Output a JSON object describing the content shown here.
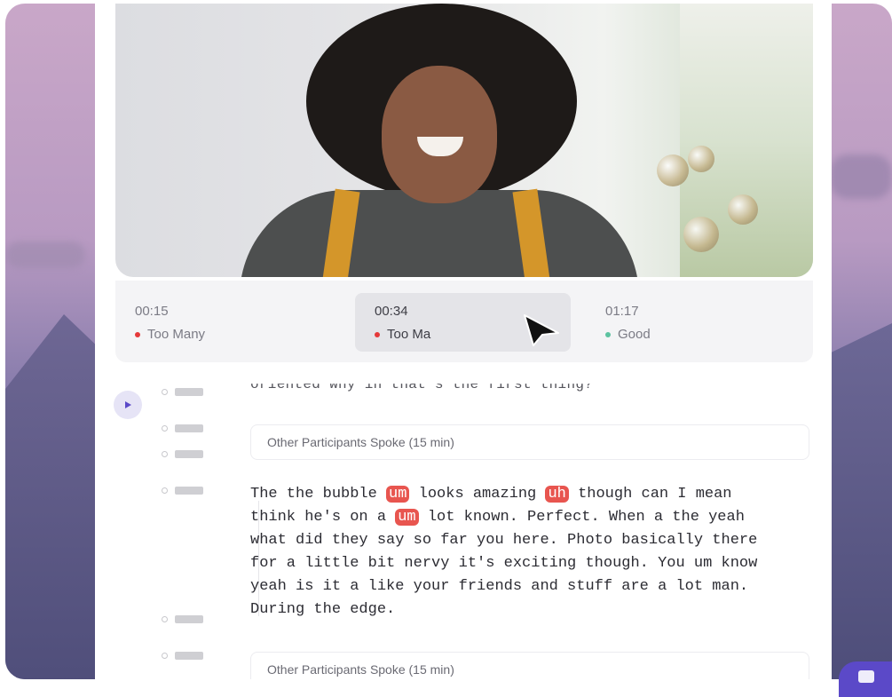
{
  "timeline": {
    "segments": [
      {
        "time": "00:15",
        "status": "Too Many",
        "status_color": "#e5393a",
        "active": false
      },
      {
        "time": "00:34",
        "status": "Too Ma",
        "status_color": "#e5393a",
        "active": true
      },
      {
        "time": "01:17",
        "status": "Good",
        "status_color": "#5cc2a0",
        "active": false
      }
    ]
  },
  "transcript": {
    "cutoff_line": "oriented why in that's the first thing?",
    "other_participants_1": "Other Participants Spoke (15 min)",
    "other_participants_2": "Other Participants Spoke (15 min)",
    "para": {
      "t1": "The the bubble ",
      "h1": "um",
      "t2": " looks amazing ",
      "h2": "uh",
      "t3": " though can I mean\nthink he's on a ",
      "h3": "um",
      "t4": " lot known. Perfect. When a the yeah\nwhat did they say so far you here. Photo basically there\nfor a little bit nervy it's exciting though. You um know\nyeah is it a like your friends and stuff are a lot man.\nDuring the edge."
    }
  },
  "colors": {
    "filler_highlight": "#e8554f",
    "accent": "#5b49c8",
    "play_bg": "#e6e4f6"
  },
  "icons": {
    "play": "play-icon",
    "cursor": "mouse-pointer-icon"
  }
}
